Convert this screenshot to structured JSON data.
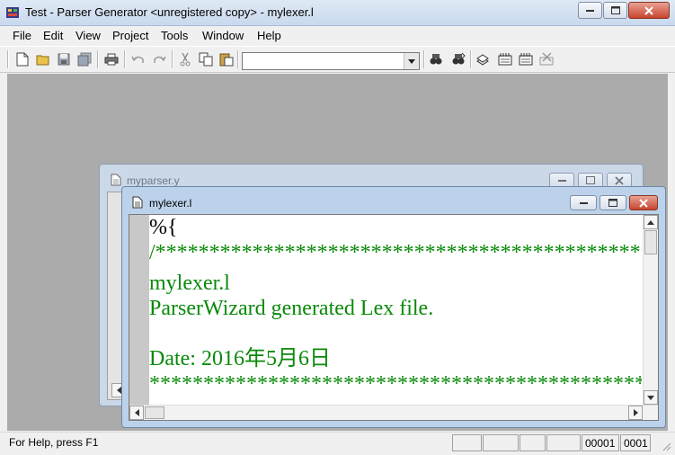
{
  "window": {
    "title": "Test - Parser Generator <unregistered copy> - mylexer.l",
    "controls": [
      "minimize",
      "maximize",
      "close"
    ]
  },
  "menubar": {
    "items": [
      "File",
      "Edit",
      "View",
      "Project",
      "Tools",
      "Window",
      "Help"
    ]
  },
  "toolbar": {
    "buttons": [
      {
        "icon": "new-file-icon"
      },
      {
        "icon": "open-folder-icon"
      },
      {
        "icon": "save-icon"
      },
      {
        "icon": "save-all-icon"
      },
      {
        "icon": "print-icon"
      },
      {
        "icon": "undo-icon"
      },
      {
        "icon": "redo-icon"
      },
      {
        "icon": "cut-icon"
      },
      {
        "icon": "copy-icon"
      },
      {
        "icon": "paste-icon"
      },
      {
        "icon": "find-icon"
      },
      {
        "icon": "find-next-icon"
      },
      {
        "icon": "build-icon"
      },
      {
        "icon": "compile-icon"
      },
      {
        "icon": "rebuild-icon"
      },
      {
        "icon": "stop-build-icon"
      }
    ],
    "combo_value": ""
  },
  "child_windows": [
    {
      "title": "myparser.y",
      "active": false
    },
    {
      "title": "mylexer.l",
      "active": true
    }
  ],
  "editor": {
    "lines": [
      "%{",
      "/*******************************************************",
      "mylexer.l",
      "ParserWizard generated Lex file.",
      "",
      "Date: 2016年5月6日",
      "*******************************************************"
    ],
    "first_line_color": "#000000",
    "comment_color": "#0a8a0a"
  },
  "statusbar": {
    "text": "For Help, press F1",
    "line": "00001",
    "col": "0001"
  }
}
